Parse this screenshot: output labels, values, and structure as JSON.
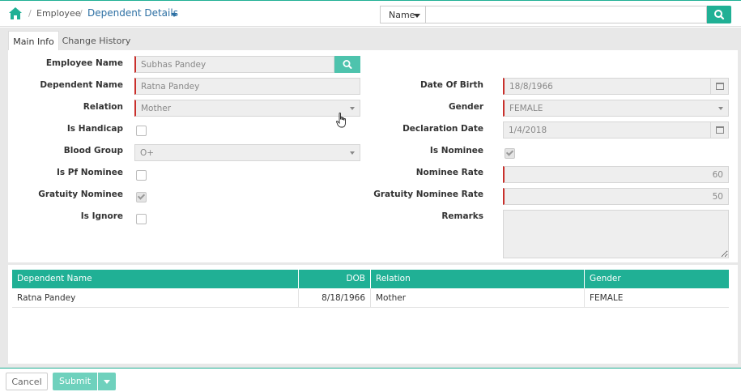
{
  "breadcrumb": {
    "separator": "/",
    "employee": "Employee",
    "current": "Dependent Details"
  },
  "search": {
    "select_value": "Name",
    "placeholder": ""
  },
  "tabs": [
    {
      "label": "Main Info",
      "active": true
    },
    {
      "label": "Change History",
      "active": false
    }
  ],
  "form": {
    "employee_name": {
      "label": "Employee Name",
      "value": "Subhas Pandey"
    },
    "dependent_name": {
      "label": "Dependent Name",
      "value": "Ratna Pandey"
    },
    "relation": {
      "label": "Relation",
      "value": "Mother"
    },
    "is_handicap": {
      "label": "Is Handicap",
      "checked": false
    },
    "blood_group": {
      "label": "Blood Group",
      "value": "O+"
    },
    "is_pf_nominee": {
      "label": "Is Pf Nominee",
      "checked": false
    },
    "gratuity_nominee": {
      "label": "Gratuity Nominee",
      "checked": true
    },
    "is_ignore": {
      "label": "Is Ignore",
      "checked": false
    },
    "date_of_birth": {
      "label": "Date Of Birth",
      "value": "18/8/1966"
    },
    "gender": {
      "label": "Gender",
      "value": "FEMALE"
    },
    "declaration_date": {
      "label": "Declaration Date",
      "value": "1/4/2018"
    },
    "is_nominee": {
      "label": "Is Nominee",
      "checked": true
    },
    "nominee_rate": {
      "label": "Nominee Rate",
      "value": "60"
    },
    "gratuity_nominee_rate": {
      "label": "Gratuity Nominee Rate",
      "value": "50"
    },
    "remarks": {
      "label": "Remarks",
      "value": ""
    }
  },
  "grid": {
    "columns": [
      "Dependent Name",
      "DOB",
      "Relation",
      "Gender"
    ],
    "rows": [
      [
        "Ratna Pandey",
        "8/18/1966",
        "Mother",
        "FEMALE"
      ]
    ]
  },
  "footer": {
    "cancel_label": "Cancel",
    "submit_label": "Submit"
  },
  "colors": {
    "accent": "#20b095",
    "link": "#2c6fa3",
    "required": "#c9302c"
  }
}
